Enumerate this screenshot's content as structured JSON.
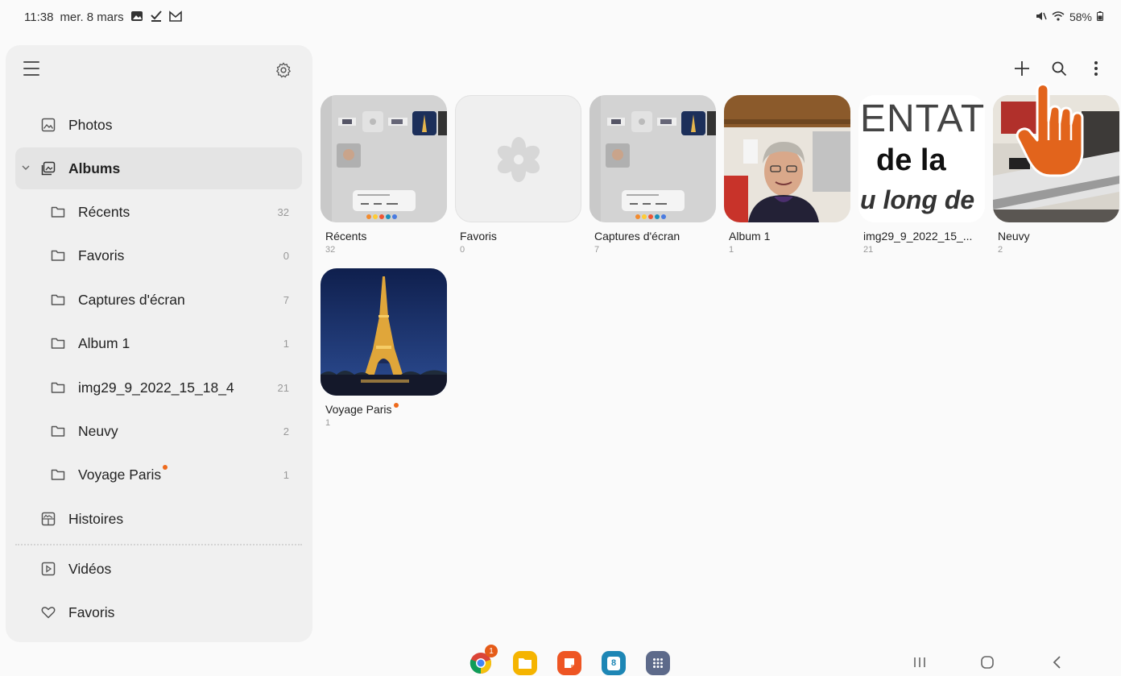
{
  "status": {
    "time": "11:38",
    "date": "mer. 8 mars",
    "battery": "58%"
  },
  "sidebar": {
    "items": [
      {
        "label": "Photos"
      },
      {
        "label": "Albums"
      },
      {
        "label": "Récents",
        "count": "32"
      },
      {
        "label": "Favoris",
        "count": "0"
      },
      {
        "label": "Captures d'écran",
        "count": "7"
      },
      {
        "label": "Album 1",
        "count": "1"
      },
      {
        "label": "img29_9_2022_15_18_4",
        "count": "21"
      },
      {
        "label": "Neuvy",
        "count": "2"
      },
      {
        "label": "Voyage Paris",
        "count": "1"
      },
      {
        "label": "Histoires"
      },
      {
        "label": "Vidéos"
      },
      {
        "label": "Favoris"
      }
    ]
  },
  "albums": [
    {
      "name": "Récents",
      "count": "32"
    },
    {
      "name": "Favoris",
      "count": "0"
    },
    {
      "name": "Captures d'écran",
      "count": "7"
    },
    {
      "name": "Album 1",
      "count": "1"
    },
    {
      "name": "img29_9_2022_15_...",
      "count": "21"
    },
    {
      "name": "Neuvy",
      "count": "2"
    },
    {
      "name": "Voyage Paris",
      "count": "1"
    }
  ],
  "thumb_text": {
    "img_line1": "ENTAT",
    "img_line2": "de la",
    "img_line3": "u long de"
  },
  "dock": {
    "chrome_badge": "1",
    "calendar_day": "8"
  },
  "colors": {
    "accent": "#ee6a1c",
    "sidebar_bg": "#f0f0f0",
    "selected_bg": "#e4e4e4"
  }
}
